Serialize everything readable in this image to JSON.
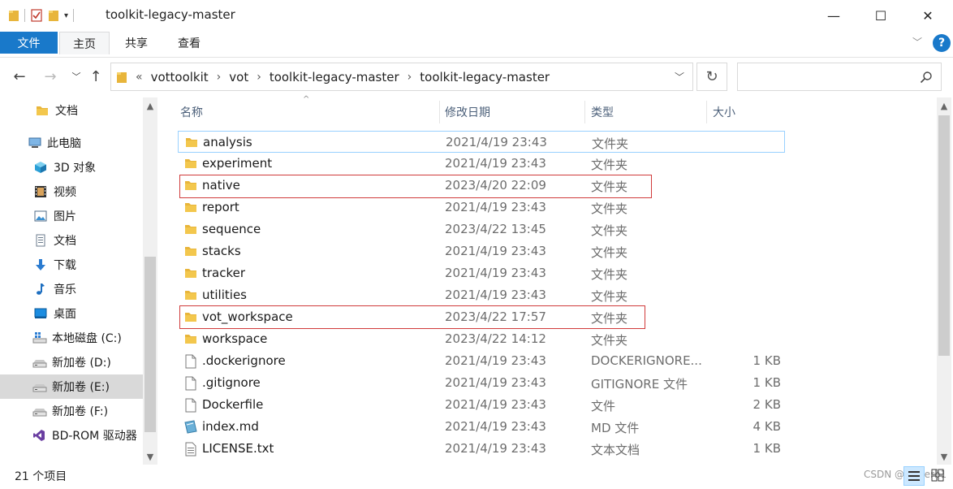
{
  "window": {
    "title": "toolkit-legacy-master",
    "minimize_glyph": "—",
    "maximize_glyph": "☐",
    "close_glyph": "✕"
  },
  "ribbon": {
    "tabs": [
      "文件",
      "主页",
      "共享",
      "查看"
    ],
    "active_tab": "主页",
    "help_glyph": "?",
    "collapse_glyph": "﹀"
  },
  "address": {
    "overflow": "«",
    "crumbs": [
      "vottoolkit",
      "vot",
      "toolkit-legacy-master",
      "toolkit-legacy-master"
    ],
    "separator": "›",
    "dropdown_glyph": "﹀",
    "refresh_glyph": "↻",
    "search_placeholder": "",
    "back_glyph": "←",
    "forward_glyph": "→",
    "recent_glyph": "﹀",
    "up_glyph": "↑"
  },
  "nav": {
    "items": [
      {
        "label": "文档",
        "icon": "folder-icon"
      },
      {
        "label": "此电脑",
        "icon": "computer-icon"
      },
      {
        "label": "3D 对象",
        "icon": "3d-objects-icon"
      },
      {
        "label": "视频",
        "icon": "video-icon"
      },
      {
        "label": "图片",
        "icon": "pictures-icon"
      },
      {
        "label": "文档",
        "icon": "documents-icon"
      },
      {
        "label": "下载",
        "icon": "download-icon"
      },
      {
        "label": "音乐",
        "icon": "music-icon"
      },
      {
        "label": "桌面",
        "icon": "desktop-icon"
      },
      {
        "label": "本地磁盘 (C:)",
        "icon": "windows-drive-icon"
      },
      {
        "label": "新加卷 (D:)",
        "icon": "drive-icon"
      },
      {
        "label": "新加卷 (E:)",
        "icon": "drive-icon"
      },
      {
        "label": "新加卷 (F:)",
        "icon": "drive-icon"
      },
      {
        "label": "BD-ROM 驱动器",
        "icon": "visual-studio-icon"
      }
    ],
    "selected": "新加卷 (E:)"
  },
  "columns": {
    "name": "名称",
    "date": "修改日期",
    "type": "类型",
    "size": "大小",
    "sort_glyph": "^"
  },
  "files": [
    {
      "name": "analysis",
      "date": "2021/4/19 23:43",
      "type": "文件夹",
      "size": "",
      "icon": "folder-icon"
    },
    {
      "name": "experiment",
      "date": "2021/4/19 23:43",
      "type": "文件夹",
      "size": "",
      "icon": "folder-icon"
    },
    {
      "name": "native",
      "date": "2023/4/20 22:09",
      "type": "文件夹",
      "size": "",
      "icon": "folder-icon"
    },
    {
      "name": "report",
      "date": "2021/4/19 23:43",
      "type": "文件夹",
      "size": "",
      "icon": "folder-icon"
    },
    {
      "name": "sequence",
      "date": "2023/4/22 13:45",
      "type": "文件夹",
      "size": "",
      "icon": "folder-icon"
    },
    {
      "name": "stacks",
      "date": "2021/4/19 23:43",
      "type": "文件夹",
      "size": "",
      "icon": "folder-icon"
    },
    {
      "name": "tracker",
      "date": "2021/4/19 23:43",
      "type": "文件夹",
      "size": "",
      "icon": "folder-icon"
    },
    {
      "name": "utilities",
      "date": "2021/4/19 23:43",
      "type": "文件夹",
      "size": "",
      "icon": "folder-icon"
    },
    {
      "name": "vot_workspace",
      "date": "2023/4/22 17:57",
      "type": "文件夹",
      "size": "",
      "icon": "folder-icon"
    },
    {
      "name": "workspace",
      "date": "2023/4/22 14:12",
      "type": "文件夹",
      "size": "",
      "icon": "folder-icon"
    },
    {
      "name": ".dockerignore",
      "date": "2021/4/19 23:43",
      "type": "DOCKERIGNORE...",
      "size": "1 KB",
      "icon": "file-icon"
    },
    {
      "name": ".gitignore",
      "date": "2021/4/19 23:43",
      "type": "GITIGNORE 文件",
      "size": "1 KB",
      "icon": "file-icon"
    },
    {
      "name": "Dockerfile",
      "date": "2021/4/19 23:43",
      "type": "文件",
      "size": "2 KB",
      "icon": "file-icon"
    },
    {
      "name": "index.md",
      "date": "2021/4/19 23:43",
      "type": "MD 文件",
      "size": "4 KB",
      "icon": "markdown-file-icon"
    },
    {
      "name": "LICENSE.txt",
      "date": "2021/4/19 23:43",
      "type": "文本文档",
      "size": "1 KB",
      "icon": "text-file-icon"
    }
  ],
  "status": {
    "item_count": "21 个项目"
  },
  "watermark": "CSDN @vi1kerb1"
}
